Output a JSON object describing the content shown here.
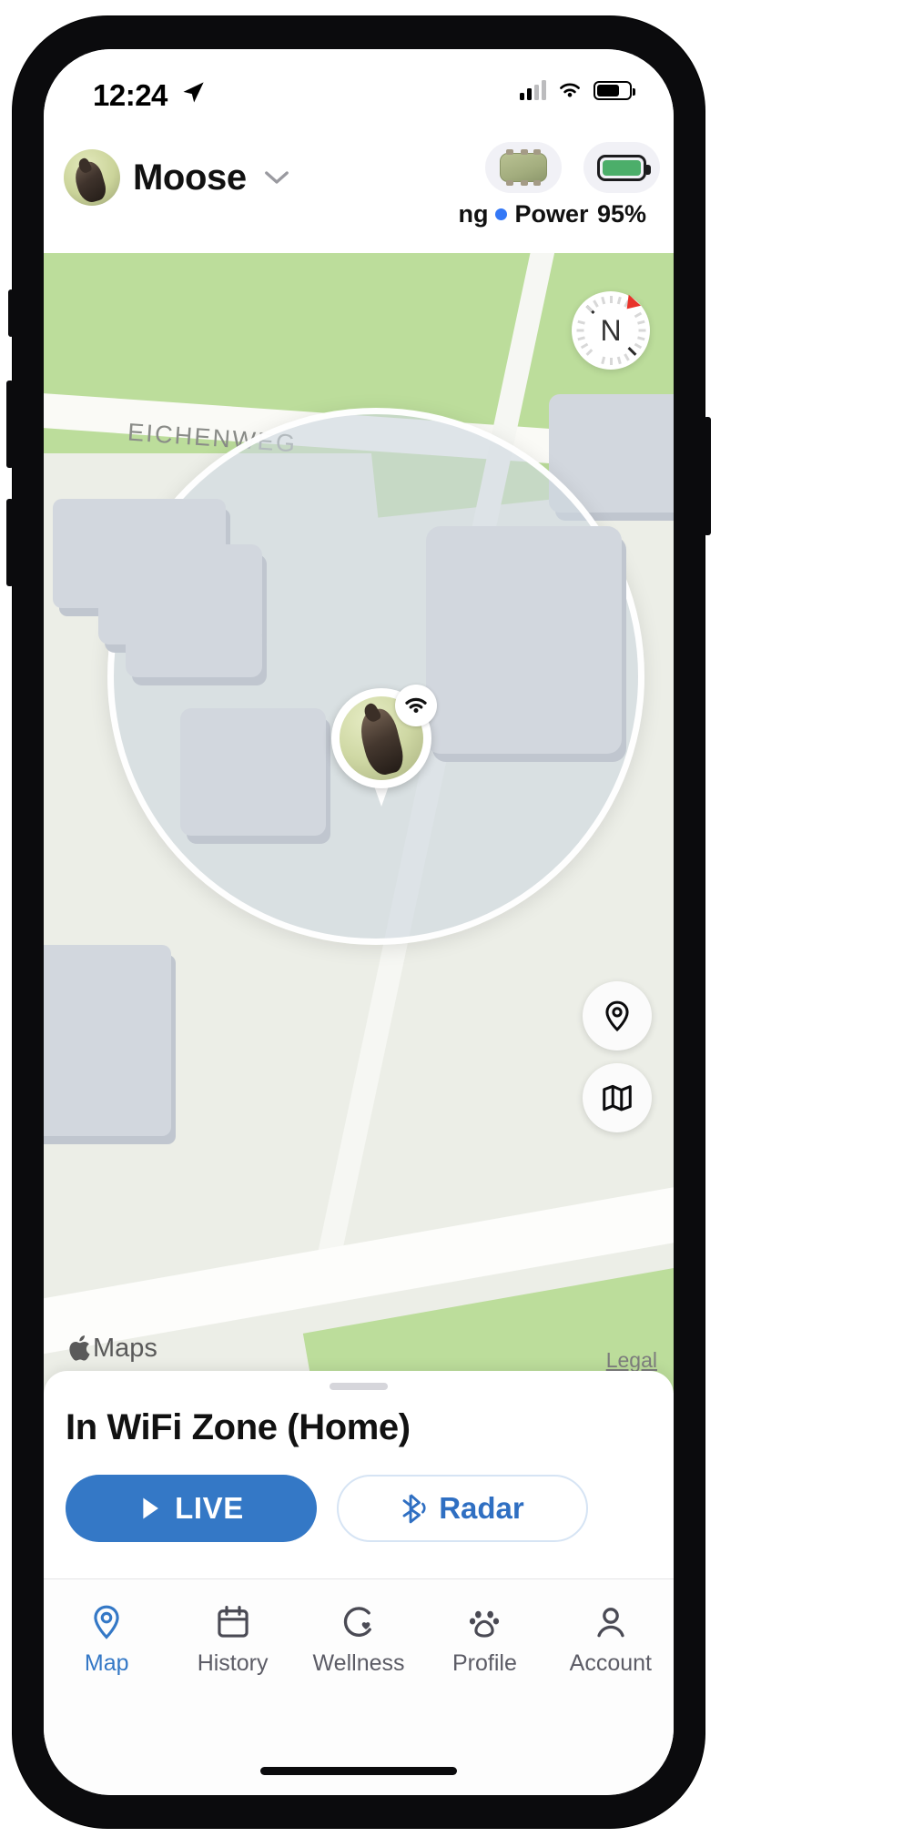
{
  "status_bar": {
    "time": "12:24",
    "location_arrow_icon": "location-arrow-icon",
    "cellular_icon": "cellular-signal-icon",
    "wifi_icon": "wifi-icon",
    "battery_icon": "battery-icon",
    "battery_fill_percent": 62
  },
  "header": {
    "avatar_name": "pet-avatar",
    "pet_name": "Moose",
    "chevron_icon": "chevron-down-icon",
    "badges": [
      {
        "name": "tracker-status-badge",
        "icon": "tracker-device-icon",
        "caption": "ng",
        "caption_full": "Tracking",
        "dot_color": "#3478f6",
        "caption2": "Power"
      },
      {
        "name": "battery-badge",
        "icon": "battery-icon",
        "caption": "95%",
        "fill_percent": 95,
        "fill_color": "#4cae6a"
      }
    ]
  },
  "map": {
    "street_label": "EICHENWEG",
    "compass": {
      "label": "N",
      "needle_color": "#e8332a"
    },
    "controls": [
      {
        "name": "locate-button",
        "icon": "map-pin-icon"
      },
      {
        "name": "map-layers-button",
        "icon": "map-fold-icon"
      }
    ],
    "attribution": "Maps",
    "apple_logo_icon": "apple-logo-icon",
    "legal_link": "Legal",
    "pet_marker": {
      "name": "pet-location-marker",
      "badge_icon": "wifi-icon"
    },
    "zone_name": "wifi-zone-circle",
    "colors": {
      "green": "#bcdd9b",
      "land": "#eceee7",
      "building": "#d2d7de",
      "zone_fill": "rgba(205,214,222,0.62)"
    }
  },
  "bottom_sheet": {
    "grabber": "sheet-grabber",
    "status_text": "In WiFi Zone (Home)",
    "live_button": {
      "label": "LIVE",
      "icon": "navigation-arrow-icon",
      "color": "#3478c6"
    },
    "radar_button": {
      "label": "Radar",
      "icon": "bluetooth-icon",
      "color": "#2f6fc2"
    }
  },
  "tab_bar": {
    "active_index": 0,
    "active_color": "#3478c6",
    "items": [
      {
        "label": "Map",
        "icon": "map-pin-icon"
      },
      {
        "label": "History",
        "icon": "calendar-icon"
      },
      {
        "label": "Wellness",
        "icon": "heart-activity-icon"
      },
      {
        "label": "Profile",
        "icon": "paw-icon"
      },
      {
        "label": "Account",
        "icon": "person-icon"
      }
    ]
  }
}
